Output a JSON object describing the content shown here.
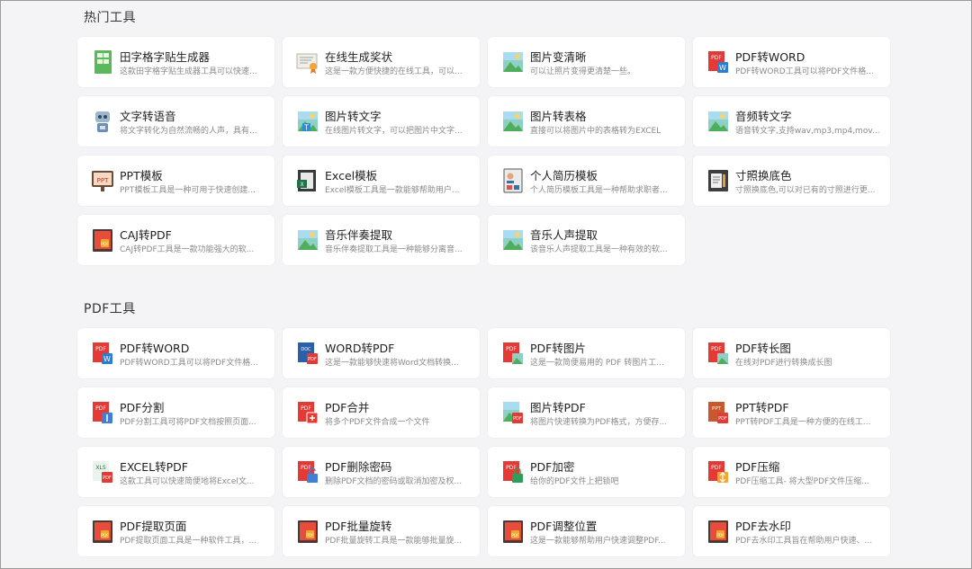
{
  "sections": [
    {
      "title": "热门工具",
      "tools": [
        {
          "name": "田字格字贴生成器",
          "desc": "这款田字格字贴生成器工具可以快速...",
          "icon": "copybook-icon"
        },
        {
          "name": "在线生成奖状",
          "desc": "这是一款方便快捷的在线工具，可以...",
          "icon": "certificate-icon"
        },
        {
          "name": "图片变清晰",
          "desc": "可以让照片变得更清楚一些。",
          "icon": "image-icon"
        },
        {
          "name": "PDF转WORD",
          "desc": "PDF转WORD工具可以将PDF文件格...",
          "icon": "pdf-to-word-icon"
        },
        {
          "name": "文字转语音",
          "desc": "将文字转化为自然流畅的人声，具有...",
          "icon": "robot-icon"
        },
        {
          "name": "图片转文字",
          "desc": "在线图片转文字，可以把图片中文字...",
          "icon": "image-text-icon"
        },
        {
          "name": "图片转表格",
          "desc": "直接可以将图片中的表格转为EXCEL",
          "icon": "image-icon"
        },
        {
          "name": "音频转文字",
          "desc": "语音转文字,支持wav,mp3,mp4,mov...",
          "icon": "image-icon"
        },
        {
          "name": "PPT模板",
          "desc": "PPT模板工具是一种可用于快速创建...",
          "icon": "ppt-template-icon"
        },
        {
          "name": "Excel模板",
          "desc": "Excel模板工具是一款能够帮助用户...",
          "icon": "excel-template-icon"
        },
        {
          "name": "个人简历模板",
          "desc": "个人简历模板工具是一种帮助求职者...",
          "icon": "resume-icon"
        },
        {
          "name": "寸照换底色",
          "desc": "寸照换底色,可以对已有的寸照进行更...",
          "icon": "id-photo-icon"
        },
        {
          "name": "CAJ转PDF",
          "desc": "CAJ转PDF工具是一款功能强大的软...",
          "icon": "book-icon"
        },
        {
          "name": "音乐伴奏提取",
          "desc": "音乐伴奏提取工具是一种能够分离音...",
          "icon": "image-icon"
        },
        {
          "name": "音乐人声提取",
          "desc": "该音乐人声提取工具是一种有效的软...",
          "icon": "image-icon"
        }
      ]
    },
    {
      "title": "PDF工具",
      "tools": [
        {
          "name": "PDF转WORD",
          "desc": "PDF转WORD工具可以将PDF文件格...",
          "icon": "pdf-to-word-icon"
        },
        {
          "name": "WORD转PDF",
          "desc": "这是一款能够快速将Word文档转换...",
          "icon": "word-to-pdf-icon"
        },
        {
          "name": "PDF转图片",
          "desc": "这是一款简便易用的 PDF 转图片工...",
          "icon": "pdf-to-image-icon"
        },
        {
          "name": "PDF转长图",
          "desc": "在线对PDF进行转换成长图",
          "icon": "pdf-to-image-icon"
        },
        {
          "name": "PDF分割",
          "desc": "PDF分割工具可将PDF文档按照页面...",
          "icon": "pdf-split-icon"
        },
        {
          "name": "PDF合并",
          "desc": "将多个PDF文件合成一个文件",
          "icon": "pdf-merge-icon"
        },
        {
          "name": "图片转PDF",
          "desc": "将图片快速转换为PDF格式，方便存...",
          "icon": "image-to-pdf-icon"
        },
        {
          "name": "PPT转PDF",
          "desc": "PPT转PDF工具是一种方便的在线工...",
          "icon": "ppt-to-pdf-icon"
        },
        {
          "name": "EXCEL转PDF",
          "desc": "这款工具可以快速简便地将Excel文...",
          "icon": "excel-to-pdf-icon"
        },
        {
          "name": "PDF删除密码",
          "desc": "删除PDF文档的密码或取消加密及权...",
          "icon": "pdf-unlock-icon"
        },
        {
          "name": "PDF加密",
          "desc": "给你的PDF文件上把锁吧",
          "icon": "pdf-encrypt-icon"
        },
        {
          "name": "PDF压缩",
          "desc": "PDF压缩工具- 将大型PDF文件压缩...",
          "icon": "pdf-compress-icon"
        },
        {
          "name": "PDF提取页面",
          "desc": "PDF提取页面工具是一种软件工具，...",
          "icon": "book-icon"
        },
        {
          "name": "PDF批量旋转",
          "desc": "PDF批量旋转工具是一款能够批量旋...",
          "icon": "book-icon"
        },
        {
          "name": "PDF调整位置",
          "desc": "这是一款能够帮助用户快速调整PDF...",
          "icon": "book-icon"
        },
        {
          "name": "PDF去水印",
          "desc": "PDF去水印工具旨在帮助用户快速、...",
          "icon": "book-icon"
        }
      ]
    }
  ]
}
